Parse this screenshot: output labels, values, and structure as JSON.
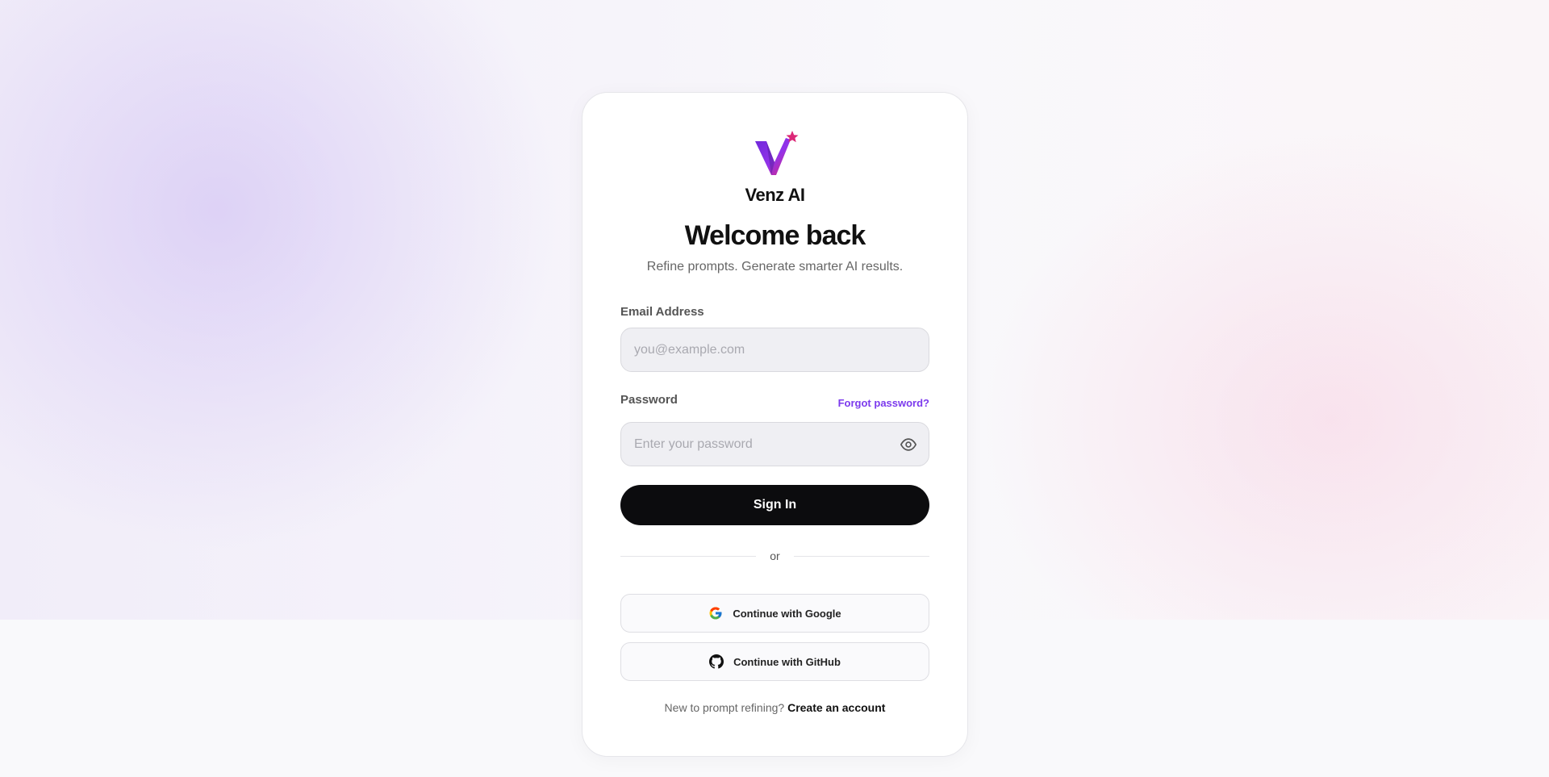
{
  "brand": {
    "name": "Venz AI",
    "logo_icon": "venz-v-star-logo",
    "colors": {
      "primary": "#7c3aed",
      "logo_pink": "#db2777",
      "logo_purple": "#6d28d9"
    }
  },
  "header": {
    "title": "Welcome back",
    "subtitle": "Refine prompts. Generate smarter AI results."
  },
  "form": {
    "email": {
      "label": "Email Address",
      "placeholder": "you@example.com",
      "value": ""
    },
    "password": {
      "label": "Password",
      "placeholder": "Enter your password",
      "value": "",
      "toggle_icon": "eye-icon",
      "forgot_label": "Forgot password?"
    },
    "submit_label": "Sign In"
  },
  "divider": {
    "label": "or"
  },
  "social": {
    "google": {
      "label": "Continue with Google",
      "icon": "google-icon"
    },
    "github": {
      "label": "Continue with GitHub",
      "icon": "github-icon"
    }
  },
  "footer": {
    "prompt": "New to prompt refining?",
    "link_label": "Create an account"
  }
}
